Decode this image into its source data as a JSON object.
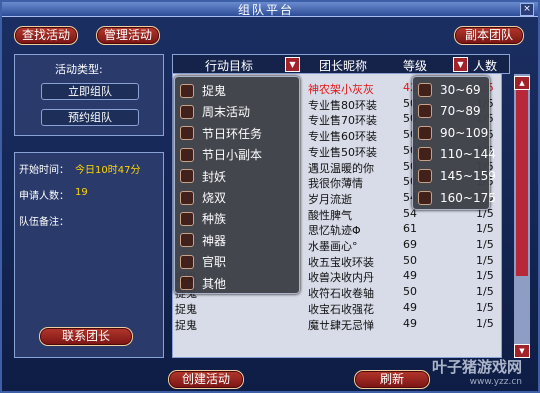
{
  "window": {
    "title": "组队平台",
    "close_label": "×"
  },
  "toolbar": {
    "find_label": "查找活动",
    "manage_label": "管理活动",
    "team_label": "副本团队"
  },
  "left_panel": {
    "type_label": "活动类型:",
    "instant_label": "立即组队",
    "reserve_label": "预约组队"
  },
  "info_panel": {
    "start_label": "开始时间：",
    "start_value": "今日10时47分",
    "applicants_label": "申请人数：",
    "applicants_value": "19",
    "note_label": "队伍备注：",
    "contact_label": "联系团长"
  },
  "table": {
    "headers": {
      "activity": "行动目标",
      "leader": "团长昵称",
      "level": "等级",
      "count": "人数"
    },
    "rows": [
      {
        "activity": "",
        "leader": "神农架小灰灰",
        "level": "42",
        "count": "1/5",
        "highlight": true
      },
      {
        "activity": "",
        "leader": "专业售80环装",
        "level": "50",
        "count": "1/5"
      },
      {
        "activity": "",
        "leader": "专业售70环装",
        "level": "50",
        "count": "1/5"
      },
      {
        "activity": "",
        "leader": "专业售60环装",
        "level": "50",
        "count": "1/5"
      },
      {
        "activity": "",
        "leader": "专业售50环装",
        "level": "50",
        "count": "1/5"
      },
      {
        "activity": "",
        "leader": "遇见温暖的你",
        "level": "50",
        "count": "1/5"
      },
      {
        "activity": "",
        "leader": "我很你薄情",
        "level": "50",
        "count": "1/5"
      },
      {
        "activity": "",
        "leader": "岁月流逝",
        "level": "54",
        "count": "1/5"
      },
      {
        "activity": "",
        "leader": "酸性脾气",
        "level": "54",
        "count": "1/5"
      },
      {
        "activity": "",
        "leader": "思忆轨迹Φ",
        "level": "61",
        "count": "1/5"
      },
      {
        "activity": "",
        "leader": "水墨画心°",
        "level": "69",
        "count": "1/5"
      },
      {
        "activity": "",
        "leader": "收五宝收环装",
        "level": "50",
        "count": "1/5"
      },
      {
        "activity": "捉鬼",
        "leader": "收兽决收内丹",
        "level": "49",
        "count": "1/5"
      },
      {
        "activity": "捉鬼",
        "leader": "收符石收卷轴",
        "level": "50",
        "count": "1/5"
      },
      {
        "activity": "捉鬼",
        "leader": "收宝石收强花",
        "level": "49",
        "count": "1/5"
      },
      {
        "activity": "捉鬼",
        "leader": "魔ㄝ肆无忌惮",
        "level": "49",
        "count": "1/5"
      }
    ]
  },
  "activity_dropdown": {
    "items": [
      "捉鬼",
      "周末活动",
      "节日环任务",
      "节日小副本",
      "封妖",
      "烧双",
      "种族",
      "神器",
      "官职",
      "其他"
    ]
  },
  "level_dropdown": {
    "items": [
      "30~69",
      "70~89",
      "90~109",
      "110~144",
      "145~159",
      "160~175"
    ]
  },
  "footer": {
    "create_label": "创建活动",
    "refresh_label": "刷新"
  },
  "watermark": {
    "brand": "叶子猪游戏网",
    "url": "www.yzz.cn"
  },
  "colors": {
    "highlight_row": "#e01818",
    "accent_red": "#a2222a",
    "value_yellow": "#ffd700"
  }
}
